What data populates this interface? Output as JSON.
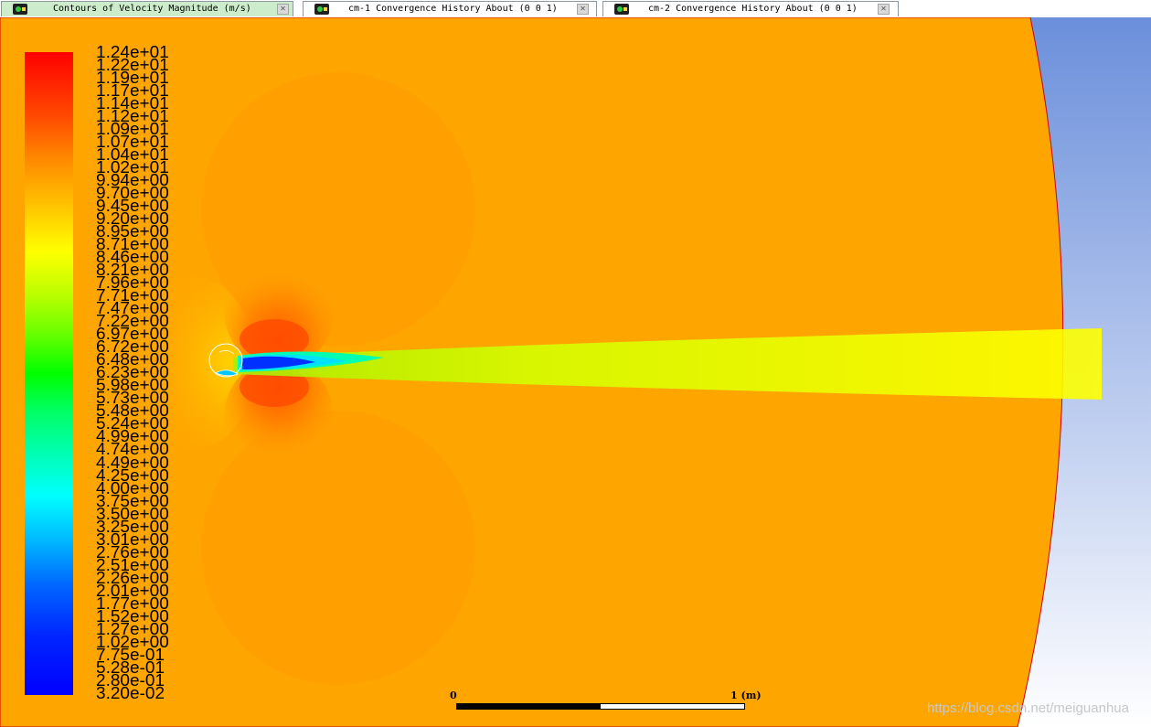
{
  "tabs": [
    {
      "label": "Contours of Velocity Magnitude (m/s)",
      "active": true
    },
    {
      "label": "cm-1 Convergence History About (0 0 1)",
      "active": false
    },
    {
      "label": "cm-2 Convergence History About (0 0 1)",
      "active": false
    }
  ],
  "legend": {
    "labels": [
      "1.24e+01",
      "1.22e+01",
      "1.19e+01",
      "1.17e+01",
      "1.14e+01",
      "1.12e+01",
      "1.09e+01",
      "1.07e+01",
      "1.04e+01",
      "1.02e+01",
      "9.94e+00",
      "9.70e+00",
      "9.45e+00",
      "9.20e+00",
      "8.95e+00",
      "8.71e+00",
      "8.46e+00",
      "8.21e+00",
      "7.96e+00",
      "7.71e+00",
      "7.47e+00",
      "7.22e+00",
      "6.97e+00",
      "6.72e+00",
      "6.48e+00",
      "6.23e+00",
      "5.98e+00",
      "5.73e+00",
      "5.48e+00",
      "5.24e+00",
      "4.99e+00",
      "4.74e+00",
      "4.49e+00",
      "4.25e+00",
      "4.00e+00",
      "3.75e+00",
      "3.50e+00",
      "3.25e+00",
      "3.01e+00",
      "2.76e+00",
      "2.51e+00",
      "2.26e+00",
      "2.01e+00",
      "1.77e+00",
      "1.52e+00",
      "1.27e+00",
      "1.02e+00",
      "7.75e-01",
      "5.28e-01",
      "2.80e-01",
      "3.20e-02"
    ],
    "colormap": [
      "#0000ff",
      "#00ffff",
      "#00ff00",
      "#ffff00",
      "#ff0000"
    ]
  },
  "scale": {
    "zero_label": "0",
    "end_label": "1 (m)"
  },
  "watermark": "https://blog.csdn.net/meiguanhua",
  "colors": {
    "freestream": "#ffa500",
    "background_top": "#6b8fdb",
    "background_bottom": "#ffffff"
  }
}
